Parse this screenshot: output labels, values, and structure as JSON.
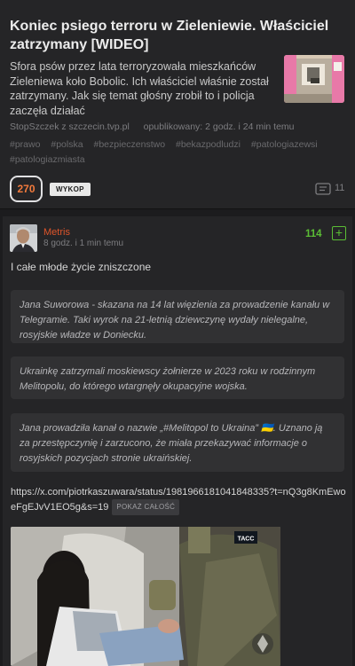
{
  "article": {
    "title": "Koniec psiego terroru w Zieleniewie. Właściciel zatrzymany [WIDEO]",
    "description": "Sfora psów przez lata terroryzowała mieszkańców Zieleniewa koło Bobolic. Ich właściciel właśnie został zatrzymany. Jak się temat głośny zrobił to i policja zaczęła działać",
    "author": "StopSzczek",
    "source": "z szczecin.tvp.pl",
    "published": "opublikowany: 2 godz. i 24 min temu",
    "tags": [
      "#prawo",
      "#polska",
      "#bezpieczenstwo",
      "#bekazpodludzi",
      "#patologiazewsi",
      "#patologiazmiasta"
    ],
    "votes": "270",
    "wykop_label": "WYKOP",
    "comments_count": "11",
    "icons": {
      "comments": "comments-icon"
    }
  },
  "comment": {
    "username": "Metris",
    "time": "8 godz. i 1 min temu",
    "score": "114",
    "plus_label": "+",
    "text": "I całe młode życie zniszczone",
    "quotes": [
      "Jana Suworowa - skazana na 14 lat więzienia za prowadzenie kanału w Telegramie. Taki wyrok na 21-letnią dziewczynę wydały nielegalne, rosyjskie władze w Doniecku.",
      "Ukrainkę zatrzymali moskiewscy żołnierze w 2023 roku w rodzinnym Melitopolu, do którego wtargnęły okupacyjne wojska.",
      "Jana prowadziła kanał o nazwie „#Melitopol to Ukraina” 🇺🇦. Uznano ją za przestępczynię i zarzucono, że miała przekazywać informacje o rosyjskich pozycjach stronie ukraińskiej."
    ],
    "link": "https://x.com/piotrkaszuwara/status/1981966181041848335?t=nQ3g8KmEwoeFgEJvV1EO5g&s=19",
    "show_all_label": "POKAŻ CAŁOŚĆ",
    "embed_watermark": "ТАСС"
  },
  "colors": {
    "background": "#1c1c1e",
    "card": "#252527",
    "vote_orange": "#f27a3c",
    "username_red": "#e0552a",
    "score_green": "#5bbd35"
  }
}
